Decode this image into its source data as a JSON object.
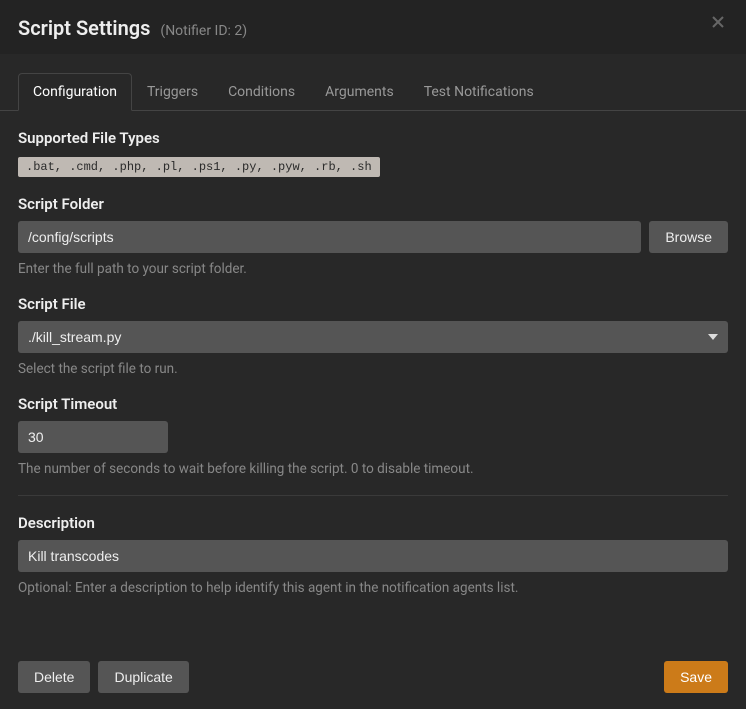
{
  "header": {
    "title": "Script Settings",
    "subtitle": "(Notifier ID: 2)"
  },
  "tabs": [
    {
      "label": "Configuration",
      "active": true
    },
    {
      "label": "Triggers",
      "active": false
    },
    {
      "label": "Conditions",
      "active": false
    },
    {
      "label": "Arguments",
      "active": false
    },
    {
      "label": "Test Notifications",
      "active": false
    }
  ],
  "sections": {
    "supported": {
      "label": "Supported File Types",
      "value": ".bat, .cmd, .php, .pl, .ps1, .py, .pyw, .rb, .sh"
    },
    "folder": {
      "label": "Script Folder",
      "value": "/config/scripts",
      "browse": "Browse",
      "help": "Enter the full path to your script folder."
    },
    "file": {
      "label": "Script File",
      "value": "./kill_stream.py",
      "help": "Select the script file to run."
    },
    "timeout": {
      "label": "Script Timeout",
      "value": "30",
      "help": "The number of seconds to wait before killing the script. 0 to disable timeout."
    },
    "description": {
      "label": "Description",
      "value": "Kill transcodes",
      "help": "Optional: Enter a description to help identify this agent in the notification agents list."
    }
  },
  "footer": {
    "delete": "Delete",
    "duplicate": "Duplicate",
    "save": "Save"
  }
}
